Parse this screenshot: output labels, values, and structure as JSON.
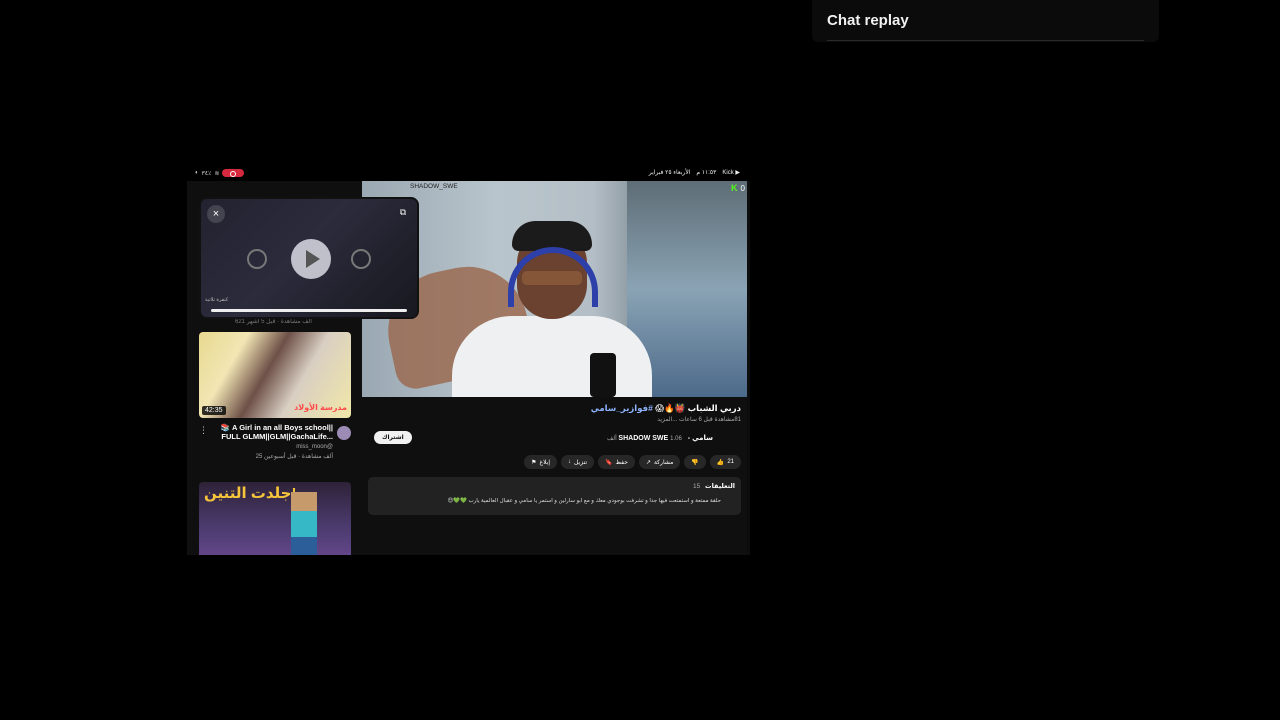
{
  "chat": {
    "title": "Chat replay"
  },
  "status_bar": {
    "battery": "٣٤٪",
    "time": "١١:٥٣ م",
    "date": "الأربعاء ٢٥ فبراير",
    "app": "Kick"
  },
  "pip": {
    "close_glyph": "×",
    "expand_glyph": "⧉",
    "subtitle": "كنفرة ثلاثية",
    "below_meta": "621 ألف مشاهدة · قبل 5 أشهر"
  },
  "recommendations": [
    {
      "duration": "42:35",
      "thumb_text": "مدرسة الأولاد",
      "title": "📚 A Girl in an all Boys school|| FULL GLMM||GLM||GachaLife...",
      "channel": "miss_moon@",
      "meta": "25 ألف مشاهدة · قبل أسبوعين"
    },
    {
      "thumb_title": "جلدت التنين!",
      "title": "",
      "meta": ""
    }
  ],
  "video": {
    "handle": "SHADOW_SWE",
    "kick_viewers": "0",
    "title_prefix": "دربي الشباب",
    "title_emojis": "👹🔥😱",
    "title_hashtag": "#فوازير_سامي",
    "meta": "81مشاهدة  قبل 6 ساعات  ...المزيد",
    "channel_name": "سامي - SHADOW SWE",
    "channel_subs": "1.06 ألف",
    "subscribe_label": "اشتراك",
    "actions": [
      {
        "icon": "like-icon",
        "glyph": "👍",
        "label": "21"
      },
      {
        "icon": "dislike-icon",
        "glyph": "👎",
        "label": ""
      },
      {
        "icon": "share-icon",
        "glyph": "↗",
        "label": "مشاركة"
      },
      {
        "icon": "save-icon",
        "glyph": "🔖",
        "label": "حفظ"
      },
      {
        "icon": "download-icon",
        "glyph": "↓",
        "label": "تنزيل"
      },
      {
        "icon": "report-icon",
        "glyph": "⚑",
        "label": "إبلاغ"
      }
    ],
    "comments_title": "التعليقات",
    "comments_count": "15",
    "top_comment": "حلقة ممتعة و استمتعت فيها جدا و تشرفت بوجودي معك و مع ابو سارلين و استمر يا سامي و عقبال العالمية يارب 💚💚😍"
  }
}
